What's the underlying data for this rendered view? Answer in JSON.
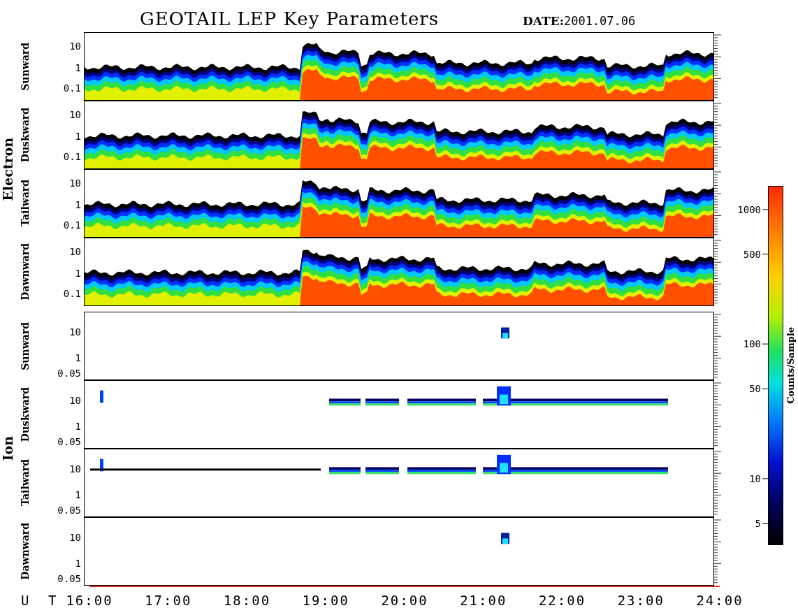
{
  "title": "GEOTAIL LEP Key Parameters",
  "date_label": "DATE:",
  "date": "2001.07.06",
  "groups": [
    {
      "label": "Electron",
      "kind": "electron",
      "panels": [
        {
          "label": "Sunward",
          "yticks": [
            "10",
            "1",
            "0.1"
          ]
        },
        {
          "label": "Duskward",
          "yticks": [
            "10",
            "1",
            "0.1"
          ]
        },
        {
          "label": "Tailward",
          "yticks": [
            "10",
            "1",
            "0.1"
          ]
        },
        {
          "label": "Dawnward",
          "yticks": [
            "10",
            "1",
            "0.1"
          ]
        }
      ]
    },
    {
      "label": "Ion",
      "kind": "ion",
      "panels": [
        {
          "label": "Sunward",
          "yticks": [
            "10",
            "1",
            "0.05"
          ]
        },
        {
          "label": "Duskward",
          "yticks": [
            "10",
            "1",
            "0.05"
          ]
        },
        {
          "label": "Tailward",
          "yticks": [
            "10",
            "1",
            "0.05"
          ]
        },
        {
          "label": "Dawnward",
          "yticks": [
            "10",
            "1",
            "0.05"
          ]
        }
      ]
    }
  ],
  "time_axis": {
    "label": "U T",
    "ticks": [
      "16:00",
      "17:00",
      "18:00",
      "19:00",
      "20:00",
      "21:00",
      "22:00",
      "23:00",
      "24:00"
    ]
  },
  "colorbar": {
    "label": "Counts/Sample",
    "ticks": [
      "1000",
      "500",
      "100",
      "50",
      "10",
      "5"
    ]
  }
}
